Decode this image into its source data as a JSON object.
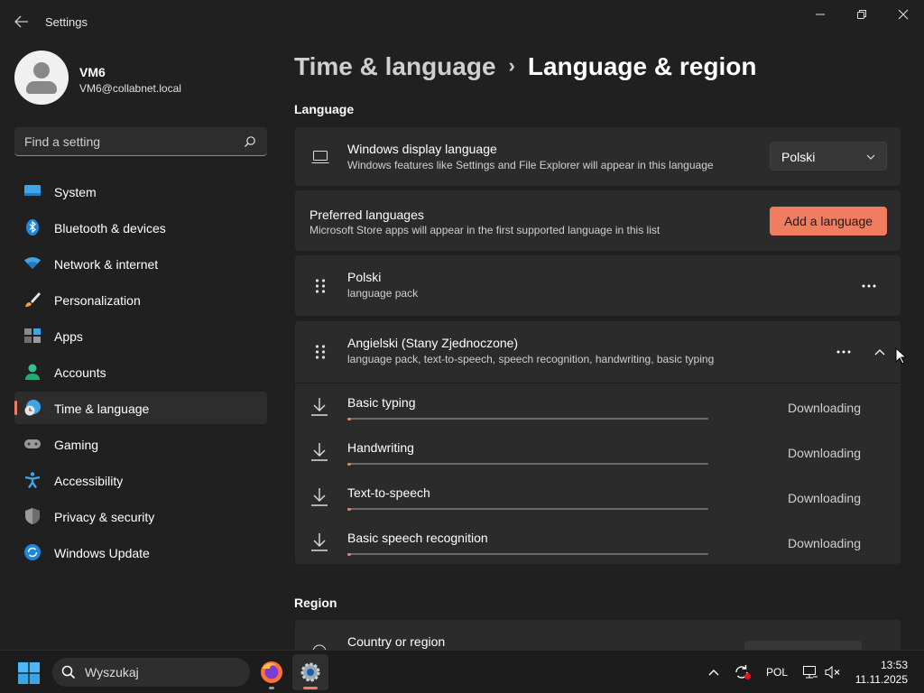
{
  "window": {
    "title": "Settings"
  },
  "profile": {
    "name": "VM6",
    "email": "VM6@collabnet.local"
  },
  "search": {
    "placeholder": "Find a setting"
  },
  "nav": {
    "items": [
      {
        "label": "System",
        "icon": "system-icon"
      },
      {
        "label": "Bluetooth & devices",
        "icon": "bluetooth-icon"
      },
      {
        "label": "Network & internet",
        "icon": "wifi-icon"
      },
      {
        "label": "Personalization",
        "icon": "brush-icon"
      },
      {
        "label": "Apps",
        "icon": "apps-icon"
      },
      {
        "label": "Accounts",
        "icon": "accounts-icon"
      },
      {
        "label": "Time & language",
        "icon": "time-language-icon",
        "active": true
      },
      {
        "label": "Gaming",
        "icon": "gamepad-icon"
      },
      {
        "label": "Accessibility",
        "icon": "accessibility-icon"
      },
      {
        "label": "Privacy & security",
        "icon": "shield-icon"
      },
      {
        "label": "Windows Update",
        "icon": "update-icon"
      }
    ]
  },
  "header": {
    "parent": "Time & language",
    "separator": "›",
    "current": "Language & region"
  },
  "language_section": {
    "title": "Language",
    "display_language": {
      "title": "Windows display language",
      "subtitle": "Windows features like Settings and File Explorer will appear in this language",
      "selected": "Polski"
    },
    "preferred": {
      "title": "Preferred languages",
      "subtitle": "Microsoft Store apps will appear in the first supported language in this list",
      "add_button": "Add a language"
    },
    "languages": [
      {
        "name": "Polski",
        "features": "language pack"
      },
      {
        "name": "Angielski (Stany Zjednoczone)",
        "features": "language pack, text-to-speech, speech recognition, handwriting, basic typing"
      }
    ],
    "downloads": [
      {
        "name": "Basic typing",
        "status": "Downloading",
        "progress": 0.01
      },
      {
        "name": "Handwriting",
        "status": "Downloading",
        "progress": 0.01
      },
      {
        "name": "Text-to-speech",
        "status": "Downloading",
        "progress": 0.01
      },
      {
        "name": "Basic speech recognition",
        "status": "Downloading",
        "progress": 0.01
      }
    ]
  },
  "region_section": {
    "title": "Region",
    "country": {
      "title": "Country or region"
    }
  },
  "taskbar": {
    "search_placeholder": "Wyszukaj",
    "language": "POL",
    "time": "13:53",
    "date": "11.11.2025"
  },
  "colors": {
    "accent": "#f07d60",
    "background": "#202020",
    "card": "#2b2b2b"
  }
}
